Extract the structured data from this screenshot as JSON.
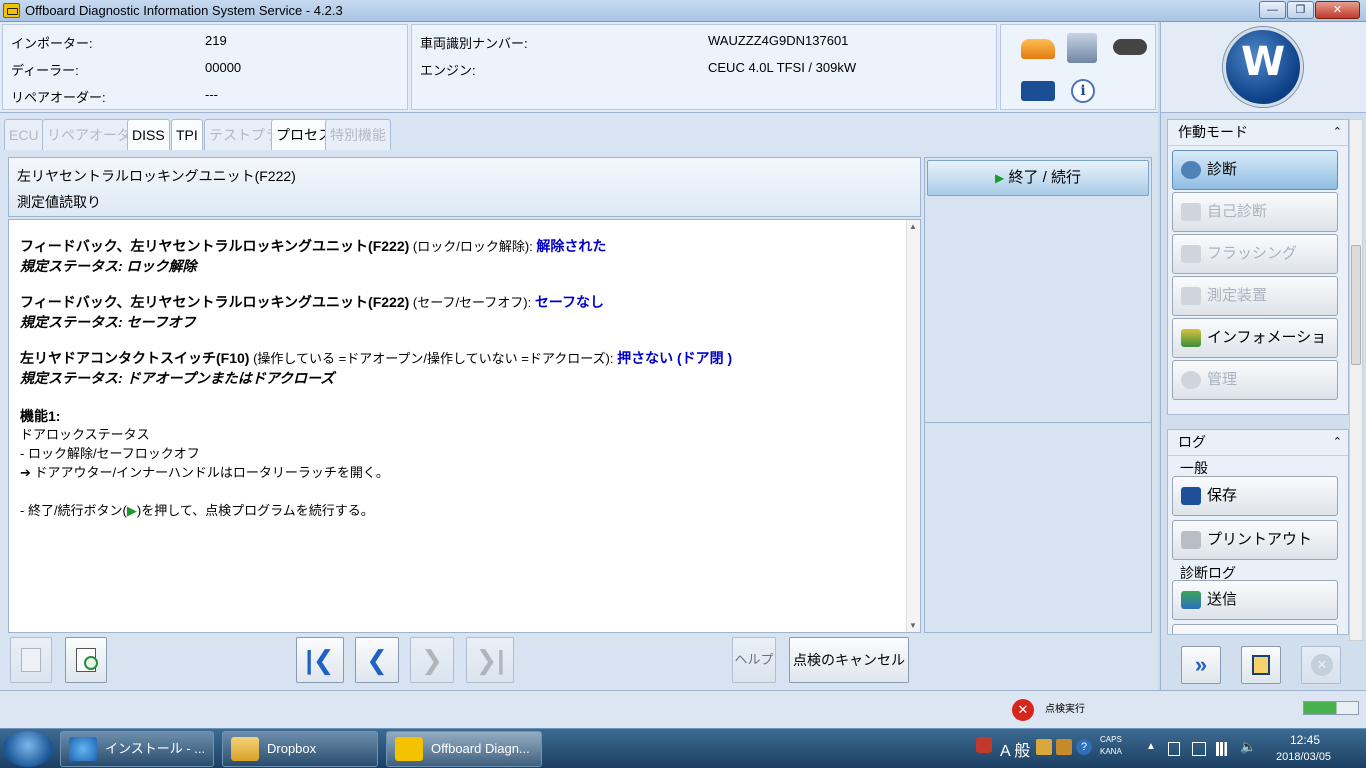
{
  "window": {
    "title": "Offboard Diagnostic Information System Service - 4.2.3",
    "min": "—",
    "max": "❐",
    "close": "✕"
  },
  "vehicle_info": {
    "importer_label": "インポーター:",
    "importer_value": "219",
    "dealer_label": "ディーラー:",
    "dealer_value": "00000",
    "repair_order_label": "リペアオーダー:",
    "repair_order_value": "---",
    "vin_label": "車両識別ナンバー:",
    "vin_value": "WAUZZZ4G9DN137601",
    "engine_label": "エンジン:",
    "engine_value": "CEUC 4.0L TFSI / 309kW"
  },
  "brand": {
    "logo_text": "W"
  },
  "tabs": [
    {
      "label": "ECU",
      "active": false
    },
    {
      "label": "リペアオーダー",
      "active": false
    },
    {
      "label": "DISS",
      "active": true
    },
    {
      "label": "TPI",
      "active": true
    },
    {
      "label": "テストプラン",
      "active": false
    },
    {
      "label": "プロセス",
      "active": true
    },
    {
      "label": "特別機能",
      "active": false
    }
  ],
  "header": {
    "title": "左リヤセントラルロッキングユニット(F222)",
    "subtitle": "測定値読取り"
  },
  "content": {
    "item1_title": "フィードバック、左リヤセントラルロッキングユニット(F222)",
    "item1_detail": " (ロック/ロック解除): ",
    "item1_value": "解除された",
    "item1_spec": "規定ステータス: ロック解除",
    "item2_title": "フィードバック、左リヤセントラルロッキングユニット(F222)",
    "item2_detail": " (セーフ/セーフオフ): ",
    "item2_value": "セーフなし",
    "item2_spec": "規定ステータス: セーフオフ",
    "item3_title": "左リヤドアコンタクトスイッチ(F10)",
    "item3_detail": "  (操作している =ドアオープン/操作していない =ドアクローズ): ",
    "item3_value": "押さない (ドア閉 )",
    "item3_spec": "規定ステータス: ドアオープンまたはドアクローズ",
    "function_title": "機能1:",
    "function_line1": "ドアロックステータス",
    "function_line2": "- ロック解除/セーフロックオフ",
    "function_line3": "➔ ドアアウター/インナーハンドルはロータリーラッチを開く。",
    "instruction_before": "- 終了/続行ボタン(",
    "instruction_arrow": "▶",
    "instruction_after": ")を押して、点検プログラムを続行する。"
  },
  "action_button": {
    "icon": "▶",
    "label": "終了 / 続行"
  },
  "bottom": {
    "help_label": "ヘルプ",
    "cancel_label": "点検のキャンセル"
  },
  "sidebar": {
    "mode_title": "作動モード",
    "mode_items": [
      {
        "label": "診断",
        "state": "active"
      },
      {
        "label": "自己診断",
        "state": "disabled"
      },
      {
        "label": "フラッシング",
        "state": "disabled"
      },
      {
        "label": "測定装置",
        "state": "disabled"
      },
      {
        "label": "インフォメーション",
        "state": "normal"
      },
      {
        "label": "管理",
        "state": "disabled"
      }
    ],
    "log_title": "ログ",
    "general_label": "一般",
    "save_label": "保存",
    "print_label": "プリントアウト",
    "diag_log_label": "診断ログ",
    "send_label": "送信",
    "collapse_icon": "≈"
  },
  "status": {
    "text": "点検実行"
  },
  "taskbar": {
    "items": [
      {
        "label": "インストール - ...",
        "active": false
      },
      {
        "label": "Dropbox",
        "active": false
      },
      {
        "label": "Offboard Diagn...",
        "active": true
      }
    ],
    "ime": "A 般",
    "caps": "CAPS",
    "kana": "KANA",
    "time": "12:45",
    "date": "2018/03/05"
  },
  "colors": {
    "accent_blue": "#0000c8",
    "titlebar": "#bcd2ec",
    "panel_bg": "#d7e3f0"
  }
}
